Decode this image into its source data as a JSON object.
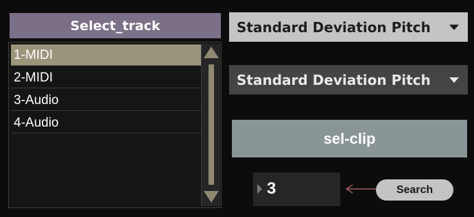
{
  "track_selector": {
    "header": "Select_track",
    "tracks": [
      "1-MIDI",
      "2-MIDI",
      "3-Audio",
      "4-Audio"
    ],
    "selected_index": 0
  },
  "dropdowns": [
    {
      "value": "Standard Deviation Pitch"
    },
    {
      "value": "Standard Deviation Pitch"
    }
  ],
  "sel_clip_label": "sel-clip",
  "number_box": {
    "value": "3"
  },
  "search_label": "Search",
  "colors": {
    "header_bg": "#7c7088",
    "selected_row": "#9b957c",
    "dropdown_light": "#c4c4c4",
    "dropdown_dark": "#444444",
    "selclip_bg": "#8a9597",
    "arrow": "#a05a5a"
  },
  "icons": {
    "scroll_up": "triangle-up-icon",
    "scroll_down": "triangle-down-icon",
    "dropdown": "caret-down-icon",
    "number": "play-triangle-icon",
    "link": "arrow-left-icon"
  }
}
